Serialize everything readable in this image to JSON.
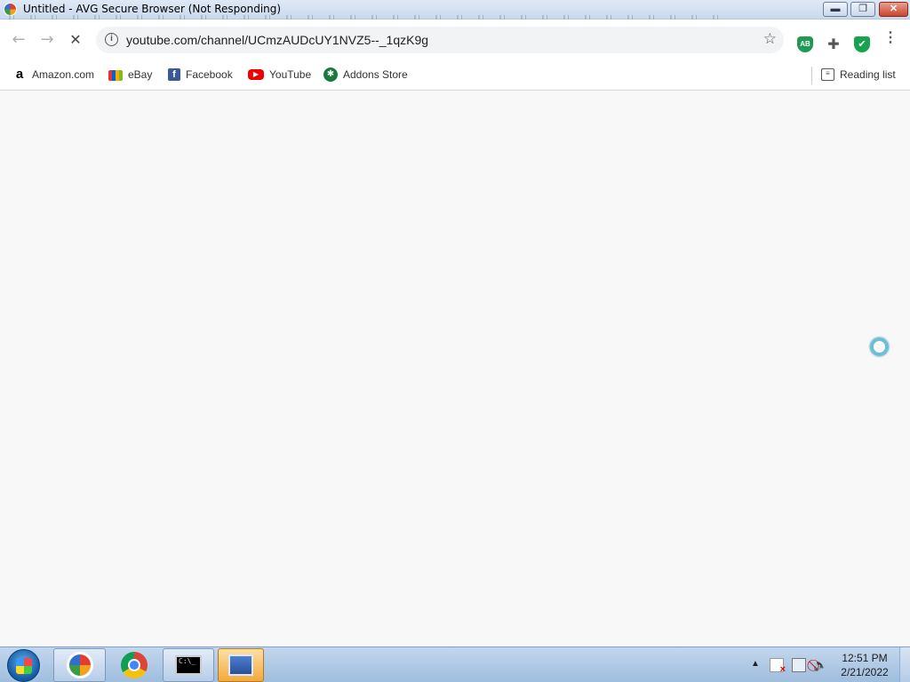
{
  "window": {
    "title": "Untitled - AVG Secure Browser (Not Responding)",
    "min_glyph": "▬",
    "max_glyph": "❐",
    "close_glyph": "✕"
  },
  "toolbar": {
    "back_glyph": "←",
    "forward_glyph": "→",
    "stop_glyph": "✕",
    "url": "youtube.com/channel/UCmzAUDcUY1NVZ5--_1qzK9g",
    "info_glyph": "i",
    "star_glyph": "☆",
    "ext_ab_label": "AB",
    "puzzle_glyph": "✚",
    "shield_glyph": "✔",
    "menu_glyph": "⋮"
  },
  "bookmarks": {
    "items": [
      {
        "label": "Amazon.com",
        "icon": "a"
      },
      {
        "label": "eBay",
        "icon": ""
      },
      {
        "label": "Facebook",
        "icon": "f"
      },
      {
        "label": "YouTube",
        "icon": "▶"
      },
      {
        "label": "Addons Store",
        "icon": "✱"
      }
    ],
    "reading_list": "Reading list",
    "reading_icon": "≡"
  },
  "taskbar": {
    "cmd_text": "C:\\_",
    "tray_arrow": "▲",
    "tray_vol_glyph": "🔈",
    "clock_time": "12:51 PM",
    "clock_date": "2/21/2022"
  },
  "icons": {
    "app": "avg-browser-icon",
    "back": "arrow-left-icon",
    "forward": "arrow-right-icon",
    "stop": "stop-loading-icon",
    "info": "site-info-icon",
    "star": "bookmark-star-icon",
    "puzzle": "extensions-puzzle-icon",
    "shield": "avg-shield-icon",
    "cursor": "busy-cursor-icon"
  },
  "colors": {
    "omnibox_bg": "#f1f3f4",
    "content_bg": "#f8f8f8",
    "taskbar_bg": "#b6cde8"
  }
}
